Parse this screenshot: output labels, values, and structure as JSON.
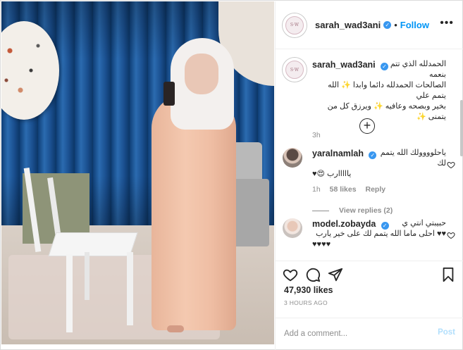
{
  "header": {
    "username": "sarah_wad3ani",
    "separator": "•",
    "follow_label": "Follow",
    "more_label": "•••"
  },
  "caption": {
    "username": "sarah_wad3ani",
    "text_line1": "الحمدلله الذي تتم بنعمه",
    "text_line2": "الصالحات الحمدلله دائما وابدا ✨ الله يتمم علي",
    "text_line3": "بخير وبصحه وعافيه ✨ ويرزق كل من يتمنى ✨",
    "time": "3h"
  },
  "comments": [
    {
      "username": "yaralnamlah",
      "text_line1": "ياحلوووولك الله يتمم لك",
      "text_line2": "يااااارب 😍♥",
      "time": "1h",
      "likes": "58 likes",
      "reply_label": "Reply",
      "view_replies": "View replies (2)"
    },
    {
      "username": "model.zobayda",
      "text_line1": "حبيبتي انتي ي",
      "text_line2": "♥♥ احلى ماما الله يتمم لك على خير يارب",
      "text_line3": "♥♥♥♥"
    }
  ],
  "actions": {
    "likes_count": "47,930 likes",
    "posted_ago": "3 HOURS AGO"
  },
  "add_comment": {
    "placeholder": "Add a comment...",
    "post_label": "Post"
  },
  "colors": {
    "accent": "#0095f6",
    "verified": "#3897f0",
    "muted": "#8e8e8e",
    "post_disabled": "#b2dffc"
  },
  "icons": {
    "like": "heart-icon",
    "comment": "comment-icon",
    "share": "paper-plane-icon",
    "save": "bookmark-icon",
    "add_comment": "plus-circle-icon"
  }
}
